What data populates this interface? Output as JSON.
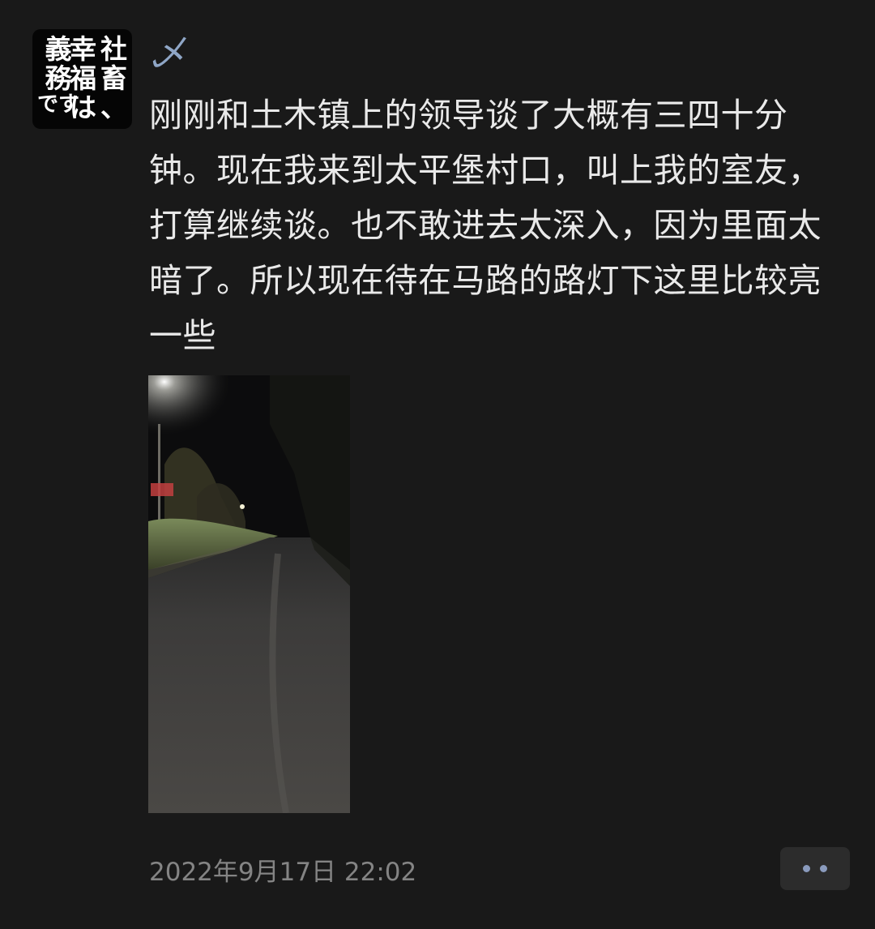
{
  "post": {
    "avatar": {
      "icon": "avatar-calligraphy",
      "columns": [
        [
          "社",
          "畜",
          "、"
        ],
        [
          "幸",
          "福",
          "は"
        ],
        [
          "義",
          "務",
          "です"
        ]
      ]
    },
    "username": "乄",
    "text": "刚刚和土木镇上的领导谈了大概有三四十分钟。现在我来到太平堡村口，叫上我的室友，打算继续谈。也不敢进去太深入，因为里面太暗了。所以现在待在马路的路灯下这里比较亮一些",
    "image": {
      "icon": "night-road-photo"
    },
    "timestamp": "2022年9月17日 22:02",
    "more_icon": "more-dots-icon"
  },
  "colors": {
    "background": "#191919",
    "text": "#e9e9e9",
    "username": "#8fa6c6",
    "timestamp": "#848484",
    "more_button_bg": "#2c2c2c",
    "more_dots": "#8a9bbd"
  }
}
